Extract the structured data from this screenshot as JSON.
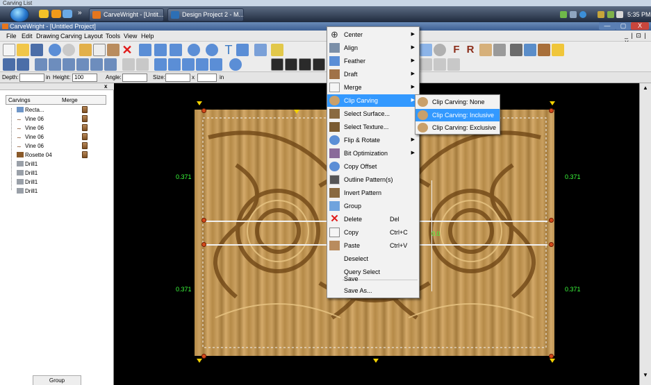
{
  "caption": "Carving List",
  "taskbar": {
    "buttons": [
      {
        "label": "CarveWright - [Untit..."
      },
      {
        "label": "Design Project 2 - M..."
      }
    ],
    "quick_launch_chevron": "»",
    "clock": "5:35 PM"
  },
  "app": {
    "title": "CarveWright - [Untitled Project]",
    "window_controls": [
      "—",
      "▢",
      "X"
    ],
    "mdi_controls": "_ | ⊡ | X"
  },
  "menubar": {
    "items": [
      "File",
      "Edit",
      "Drawing",
      "Carving",
      "Layout",
      "Tools",
      "View",
      "Help"
    ]
  },
  "propbar": {
    "depth_label": "Depth:",
    "depth_value": "",
    "in1": "in",
    "height_label": "Height:",
    "height_value": "100",
    "angle_label": "Angle:",
    "angle_value": "",
    "size_label": "Size:",
    "size_value": "",
    "x_label": "x",
    "size_value2": "",
    "in2": "in"
  },
  "left_panel": {
    "close": "x",
    "columns": [
      "Carvings",
      "Merge"
    ],
    "tree": [
      {
        "label": "Recta..."
      },
      {
        "label": "Vine 06"
      },
      {
        "label": "Vine 06"
      },
      {
        "label": "Vine 06"
      },
      {
        "label": "Vine 06"
      },
      {
        "label": "Rosette 04"
      },
      {
        "label": "Drill1"
      },
      {
        "label": "Drill1"
      },
      {
        "label": "Drill1"
      },
      {
        "label": "Drill1"
      }
    ],
    "group_button": "Group"
  },
  "canvas": {
    "dimension_labels": [
      "0.371",
      "0.371",
      "0.371",
      "0.371",
      "0.0"
    ]
  },
  "context_menu": {
    "items": [
      {
        "label": "Center",
        "submenu": true,
        "icon": "center-icon"
      },
      {
        "label": "Align",
        "submenu": true,
        "icon": "align-icon"
      },
      {
        "label": "Feather",
        "submenu": true,
        "icon": "feather-icon"
      },
      {
        "label": "Draft",
        "submenu": true,
        "icon": "draft-icon"
      },
      {
        "label": "Merge",
        "submenu": true,
        "icon": "merge-icon"
      },
      {
        "label": "Clip Carving",
        "submenu": true,
        "highlighted": true,
        "icon": "clip-carving-icon"
      },
      {
        "label": "Select Surface...",
        "icon": "select-surface-icon"
      },
      {
        "label": "Select Texture...",
        "icon": "select-texture-icon"
      },
      {
        "label": "Flip & Rotate",
        "submenu": true,
        "icon": "flip-rotate-icon"
      },
      {
        "label": "Bit Optimization",
        "submenu": true,
        "icon": "bit-optimization-icon"
      },
      {
        "label": "Copy Offset",
        "icon": "copy-offset-icon"
      },
      {
        "label": "Outline Pattern(s)",
        "icon": "outline-pattern-icon"
      },
      {
        "label": "Invert Pattern",
        "icon": "invert-pattern-icon"
      },
      {
        "label": "Group",
        "icon": "group-icon"
      },
      {
        "label": "Delete",
        "shortcut": "Del",
        "icon": "delete-icon"
      },
      {
        "label": "Copy",
        "shortcut": "Ctrl+C",
        "icon": "copy-icon"
      },
      {
        "label": "Paste",
        "shortcut": "Ctrl+V",
        "icon": "paste-icon"
      },
      {
        "label": "Deselect"
      },
      {
        "label": "Query Select"
      },
      {
        "label": "Save"
      },
      {
        "label": "Save As..."
      }
    ]
  },
  "sub_menu": {
    "items": [
      {
        "label": "Clip Carving: None"
      },
      {
        "label": "Clip Carving: Inclusive",
        "highlighted": true
      },
      {
        "label": "Clip Carving: Exclusive"
      }
    ]
  },
  "colors": {
    "menu_highlight": "#3399ff",
    "dimension_green": "#3cff3c",
    "handle_red": "#d54a1a",
    "wood": "#c89c5c"
  }
}
